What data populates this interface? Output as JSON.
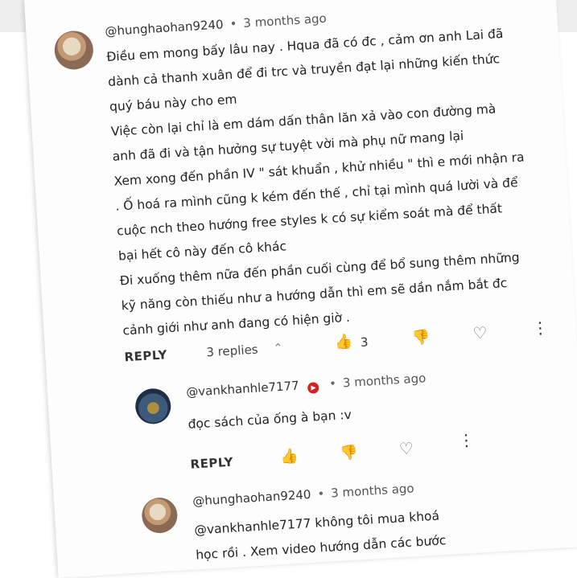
{
  "comment": {
    "username": "@hunghaohan9240",
    "time": "3 months ago",
    "lines": [
      "Điều em mong bấy lâu nay . Hqua đã có đc , cảm ơn anh Lai đã",
      "dành cả thanh xuân để đi trc và truyền đạt lại những kiến thức",
      "quý báu này cho em",
      "Việc còn lại chỉ là em dám dấn thân lăn xả vào con đường mà",
      "anh đã đi và tận hưởng sự tuyệt vời mà phụ nữ mang lại",
      "Xem xong đến phần IV \" sát khuẩn , khử nhiều \" thì e mới nhận ra",
      ". Ố hoá ra mình cũng k kém đến thế , chỉ tại mình quá lười và để",
      "cuộc nch theo hướng free styles k có sự kiểm soát mà để thất",
      "bại hết cô này đến cô khác",
      "Đi xuống thêm nữa đến phần cuối cùng để bổ sung thêm những",
      "kỹ năng còn thiếu như a hướng dẫn thì em sẽ dần nắm bắt đc",
      "cảnh giới như anh đang có hiện giờ ."
    ],
    "reply_label": "REPLY",
    "replies_label": "3 replies",
    "like_count": "3",
    "icons": {
      "like": "thumbs-up-icon",
      "dislike": "thumbs-down-icon",
      "heart": "heart-icon",
      "more": "more-vert-icon",
      "expand": "chevron-up-icon"
    }
  },
  "reply1": {
    "username": "@vankhanhle7177",
    "time": "3 months ago",
    "text": "đọc sách của ống à bạn :v",
    "reply_label": "REPLY"
  },
  "reply2": {
    "username": "@hunghaohan9240",
    "time": "3 months ago",
    "lines": [
      "@vankhanhle7177  không tôi mua khoá",
      "học rồi . Xem video hướng dẫn các bước"
    ]
  },
  "colors": {
    "badge": "#d32222",
    "text": "#222222",
    "icon": "#777777"
  }
}
